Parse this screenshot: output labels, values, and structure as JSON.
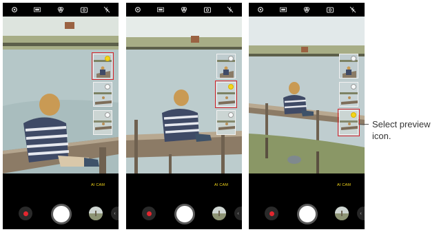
{
  "screens": [
    {
      "ai_label": "AI CAM",
      "selected_thumbnail": 1
    },
    {
      "ai_label": "AI CAM",
      "selected_thumbnail": 2
    },
    {
      "ai_label": "AI CAM",
      "selected_thumbnail": 3
    }
  ],
  "statusbar_icons": [
    "settings-icon",
    "aspect-ratio-icon",
    "filter-icon",
    "switch-camera-icon",
    "flash-off-icon"
  ],
  "callout": {
    "text": "Select preview icon."
  },
  "colors": {
    "accent_label": "#f2d51a",
    "selection_outline": "#d8232a",
    "record_dot": "#e3262f"
  }
}
